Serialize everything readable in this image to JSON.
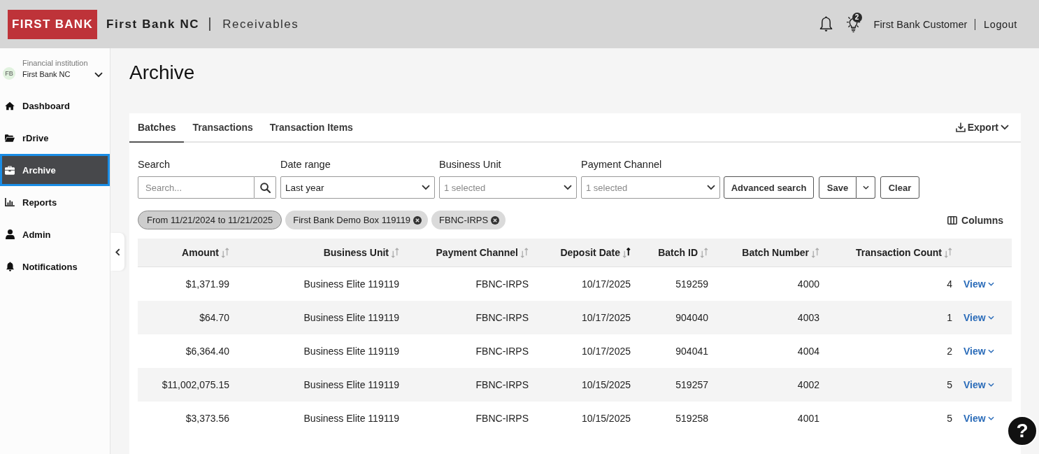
{
  "header": {
    "logo": "FIRST BANK",
    "bank_name": "First Bank NC",
    "product": "Receivables",
    "notification_count": "2",
    "user": "First Bank Customer",
    "logout": "Logout"
  },
  "sidebar": {
    "institution": {
      "initials": "FB",
      "label": "Financial institution",
      "name": "First Bank NC"
    },
    "items": [
      {
        "label": "Dashboard",
        "selected": false
      },
      {
        "label": "rDrive",
        "selected": false
      },
      {
        "label": "Archive",
        "selected": true
      },
      {
        "label": "Reports",
        "selected": false
      },
      {
        "label": "Admin",
        "selected": false
      },
      {
        "label": "Notifications",
        "selected": false
      }
    ]
  },
  "page": {
    "title": "Archive"
  },
  "tabs": [
    {
      "label": "Batches",
      "selected": true
    },
    {
      "label": "Transactions",
      "selected": false
    },
    {
      "label": "Transaction Items",
      "selected": false
    }
  ],
  "export": "Export",
  "filters": [
    {
      "kind": "search",
      "label": "Search",
      "placeholder": "Search..."
    },
    {
      "kind": "select",
      "label": "Date range",
      "value": "Last year"
    },
    {
      "kind": "select",
      "label": "Business Unit",
      "placeholder": "1 selected"
    },
    {
      "kind": "select",
      "label": "Payment Channel",
      "placeholder": "1 selected"
    }
  ],
  "actions": [
    {
      "kind": "button",
      "label": "Advanced search"
    },
    {
      "kind": "split",
      "label": "Save"
    },
    {
      "kind": "button",
      "label": "Clear"
    }
  ],
  "chips": [
    {
      "label": "From 11/21/2024 to 11/21/2025",
      "removable": false
    },
    {
      "label": "First Bank Demo Box 119119",
      "removable": true
    },
    {
      "label": "FBNC-IRPS",
      "removable": true
    }
  ],
  "columns_button": "Columns",
  "table": {
    "columns": [
      {
        "label": "Amount",
        "sorted": false
      },
      {
        "label": "Business Unit",
        "sorted": false
      },
      {
        "label": "Payment Channel",
        "sorted": false
      },
      {
        "label": "Deposit Date",
        "sorted": true
      },
      {
        "label": "Batch ID",
        "sorted": false
      },
      {
        "label": "Batch Number",
        "sorted": false
      },
      {
        "label": "Transaction Count",
        "sorted": false
      }
    ],
    "rows": [
      {
        "cells": [
          "$1,371.99",
          "Business Elite 119119",
          "FBNC-IRPS",
          "10/17/2025",
          "519259",
          "4000",
          "4"
        ],
        "action": "View"
      },
      {
        "cells": [
          "$64.70",
          "Business Elite 119119",
          "FBNC-IRPS",
          "10/17/2025",
          "904040",
          "4003",
          "1"
        ],
        "action": "View"
      },
      {
        "cells": [
          "$6,364.40",
          "Business Elite 119119",
          "FBNC-IRPS",
          "10/17/2025",
          "904041",
          "4004",
          "2"
        ],
        "action": "View"
      },
      {
        "cells": [
          "$11,002,075.15",
          "Business Elite 119119",
          "FBNC-IRPS",
          "10/15/2025",
          "519257",
          "4002",
          "5"
        ],
        "action": "View"
      },
      {
        "cells": [
          "$3,373.56",
          "Business Elite 119119",
          "FBNC-IRPS",
          "10/15/2025",
          "519258",
          "4001",
          "5"
        ],
        "action": "View"
      }
    ]
  },
  "help": "?"
}
